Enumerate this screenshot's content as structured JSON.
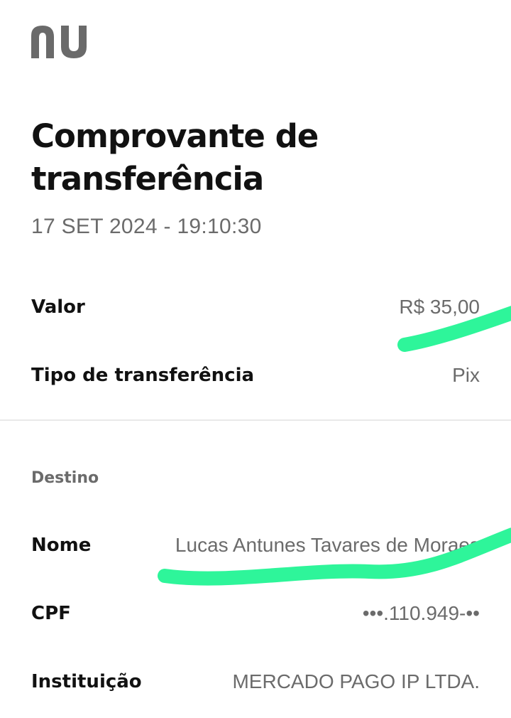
{
  "header": {
    "logo_icon": "nubank-nu-logo-icon",
    "title": "Comprovante de transferência",
    "datetime": "17 SET 2024 - 19:10:30"
  },
  "summary": {
    "amount_label": "Valor",
    "amount_value": "R$ 35,00",
    "type_label": "Tipo de transferência",
    "type_value": "Pix"
  },
  "destination": {
    "section_label": "Destino",
    "name_label": "Nome",
    "name_value": "Lucas Antunes Tavares de Moraes",
    "cpf_label": "CPF",
    "cpf_value": "•••.110.949-••",
    "institution_label": "Instituição",
    "institution_value": "MERCADO PAGO IP LTDA."
  },
  "annotations": {
    "highlight_color": "#2ef59a"
  }
}
